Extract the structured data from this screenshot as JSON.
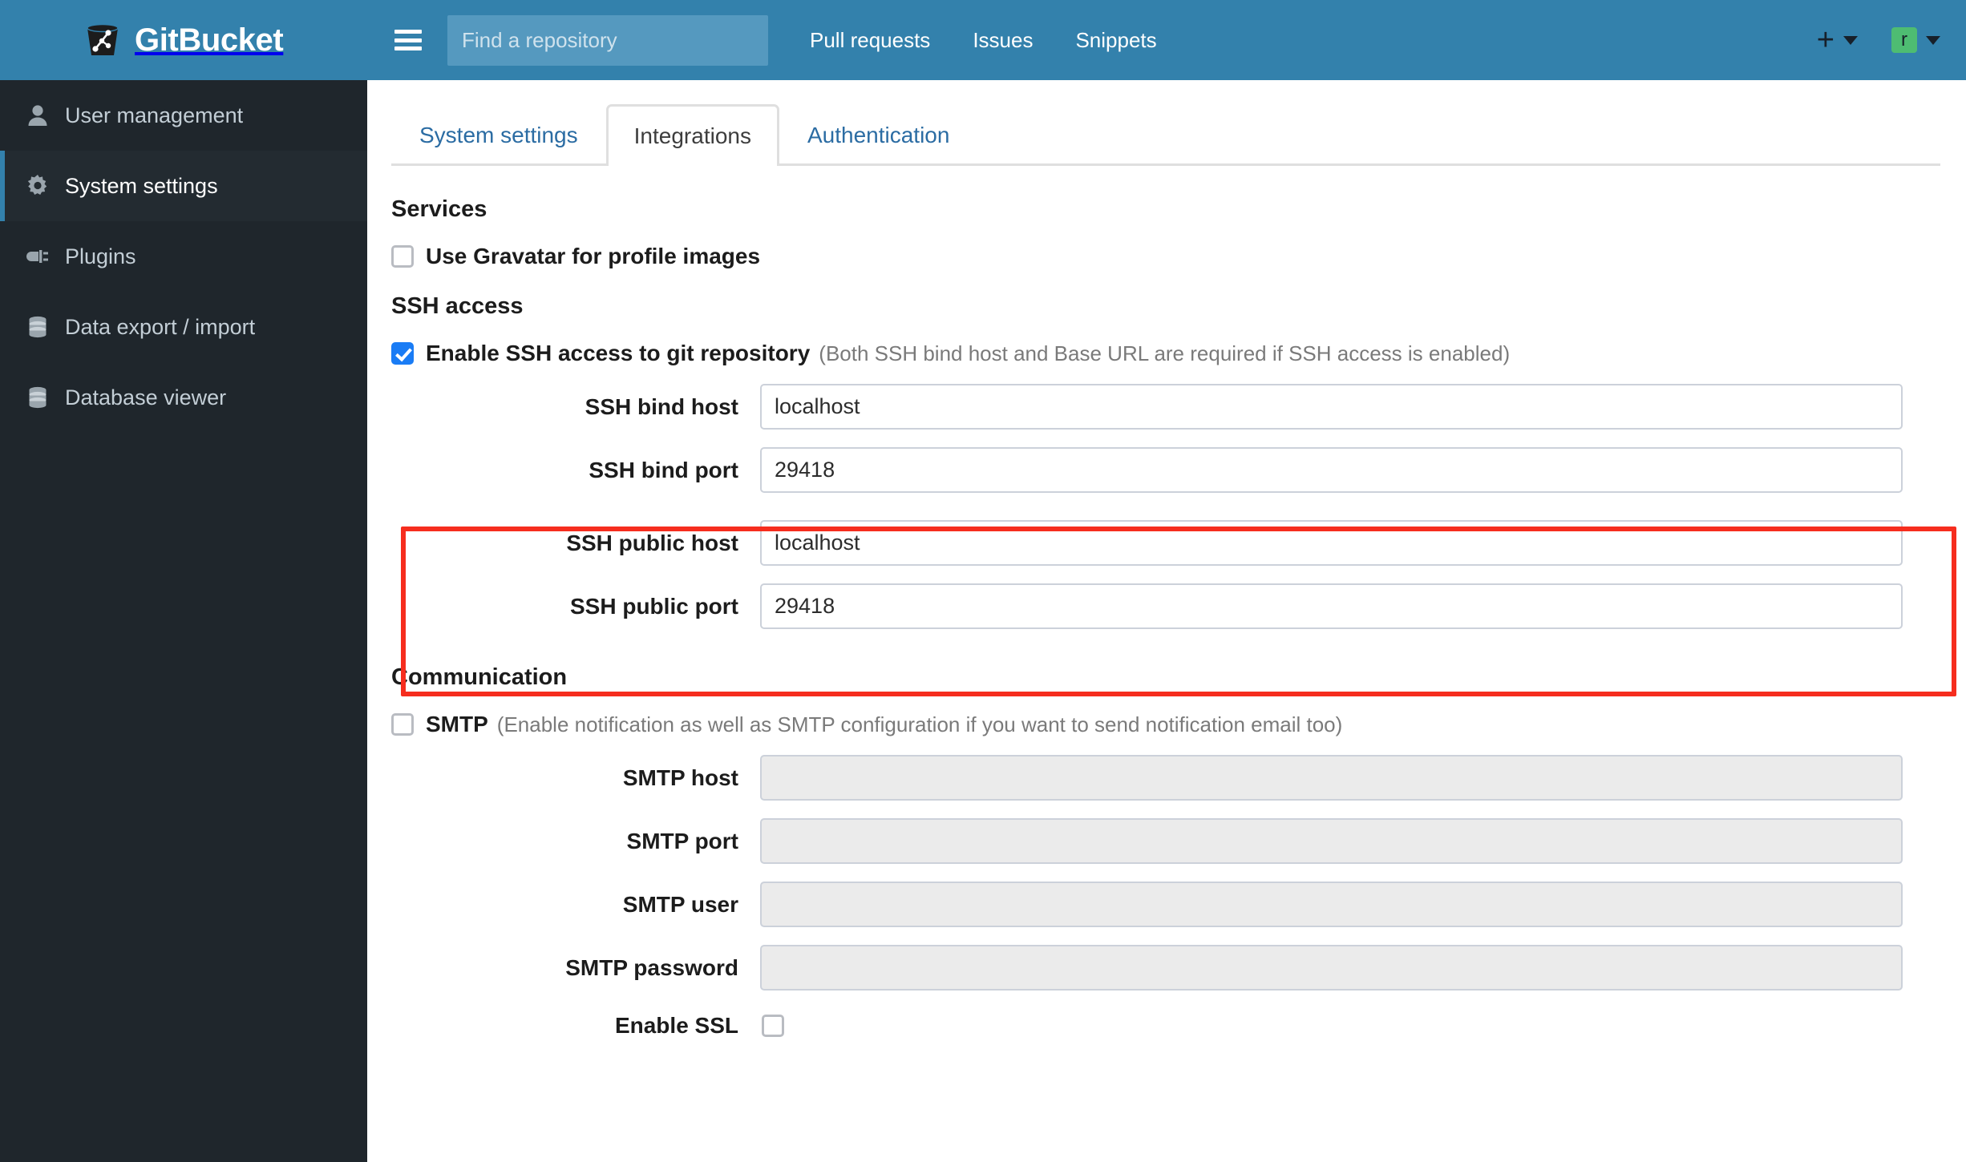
{
  "header": {
    "brand": "GitBucket",
    "logo_icon": "bucket-git-logo",
    "menu_icon": "hamburger-icon",
    "search": {
      "placeholder": "Find a repository",
      "value": ""
    },
    "nav": [
      {
        "label": "Pull requests",
        "name": "pull-requests"
      },
      {
        "label": "Issues",
        "name": "issues"
      },
      {
        "label": "Snippets",
        "name": "snippets"
      }
    ],
    "create": {
      "icon": "plus-icon",
      "caret": "chevron-down-icon"
    },
    "account": {
      "avatar_initial": "r",
      "caret": "chevron-down-icon",
      "avatar_color": "#4ebc72"
    }
  },
  "sidebar": {
    "items": [
      {
        "label": "User management",
        "icon": "user-icon",
        "active": false
      },
      {
        "label": "System settings",
        "icon": "gear-icon",
        "active": true
      },
      {
        "label": "Plugins",
        "icon": "plug-icon",
        "active": false
      },
      {
        "label": "Data export / import",
        "icon": "database-icon",
        "active": false
      },
      {
        "label": "Database viewer",
        "icon": "database-icon",
        "active": false
      }
    ]
  },
  "tabs": [
    {
      "label": "System settings",
      "active": false
    },
    {
      "label": "Integrations",
      "active": true
    },
    {
      "label": "Authentication",
      "active": false
    }
  ],
  "sections": {
    "services": {
      "title": "Services",
      "gravatar": {
        "label": "Use Gravatar for profile images",
        "checked": false
      }
    },
    "ssh": {
      "title": "SSH access",
      "enable": {
        "label": "Enable SSH access to git repository",
        "note": "(Both SSH bind host and Base URL are required if SSH access is enabled)",
        "checked": true
      },
      "fields": [
        {
          "label": "SSH bind host",
          "value": "localhost",
          "disabled": false
        },
        {
          "label": "SSH bind port",
          "value": "29418",
          "disabled": false
        },
        {
          "label": "SSH public host",
          "value": "localhost",
          "disabled": false
        },
        {
          "label": "SSH public port",
          "value": "29418",
          "disabled": false
        }
      ]
    },
    "communication": {
      "title": "Communication",
      "smtp": {
        "label": "SMTP",
        "note": "(Enable notification as well as SMTP configuration if you want to send notification email too)",
        "checked": false
      },
      "fields": [
        {
          "label": "SMTP host",
          "value": "",
          "disabled": true
        },
        {
          "label": "SMTP port",
          "value": "",
          "disabled": true
        },
        {
          "label": "SMTP user",
          "value": "",
          "disabled": true
        },
        {
          "label": "SMTP password",
          "value": "",
          "disabled": true
        }
      ],
      "ssl": {
        "label": "Enable SSL",
        "checked": false
      }
    }
  },
  "annotation": {
    "color": "#f62d1e",
    "target": "ssh-public-host-and-port"
  }
}
